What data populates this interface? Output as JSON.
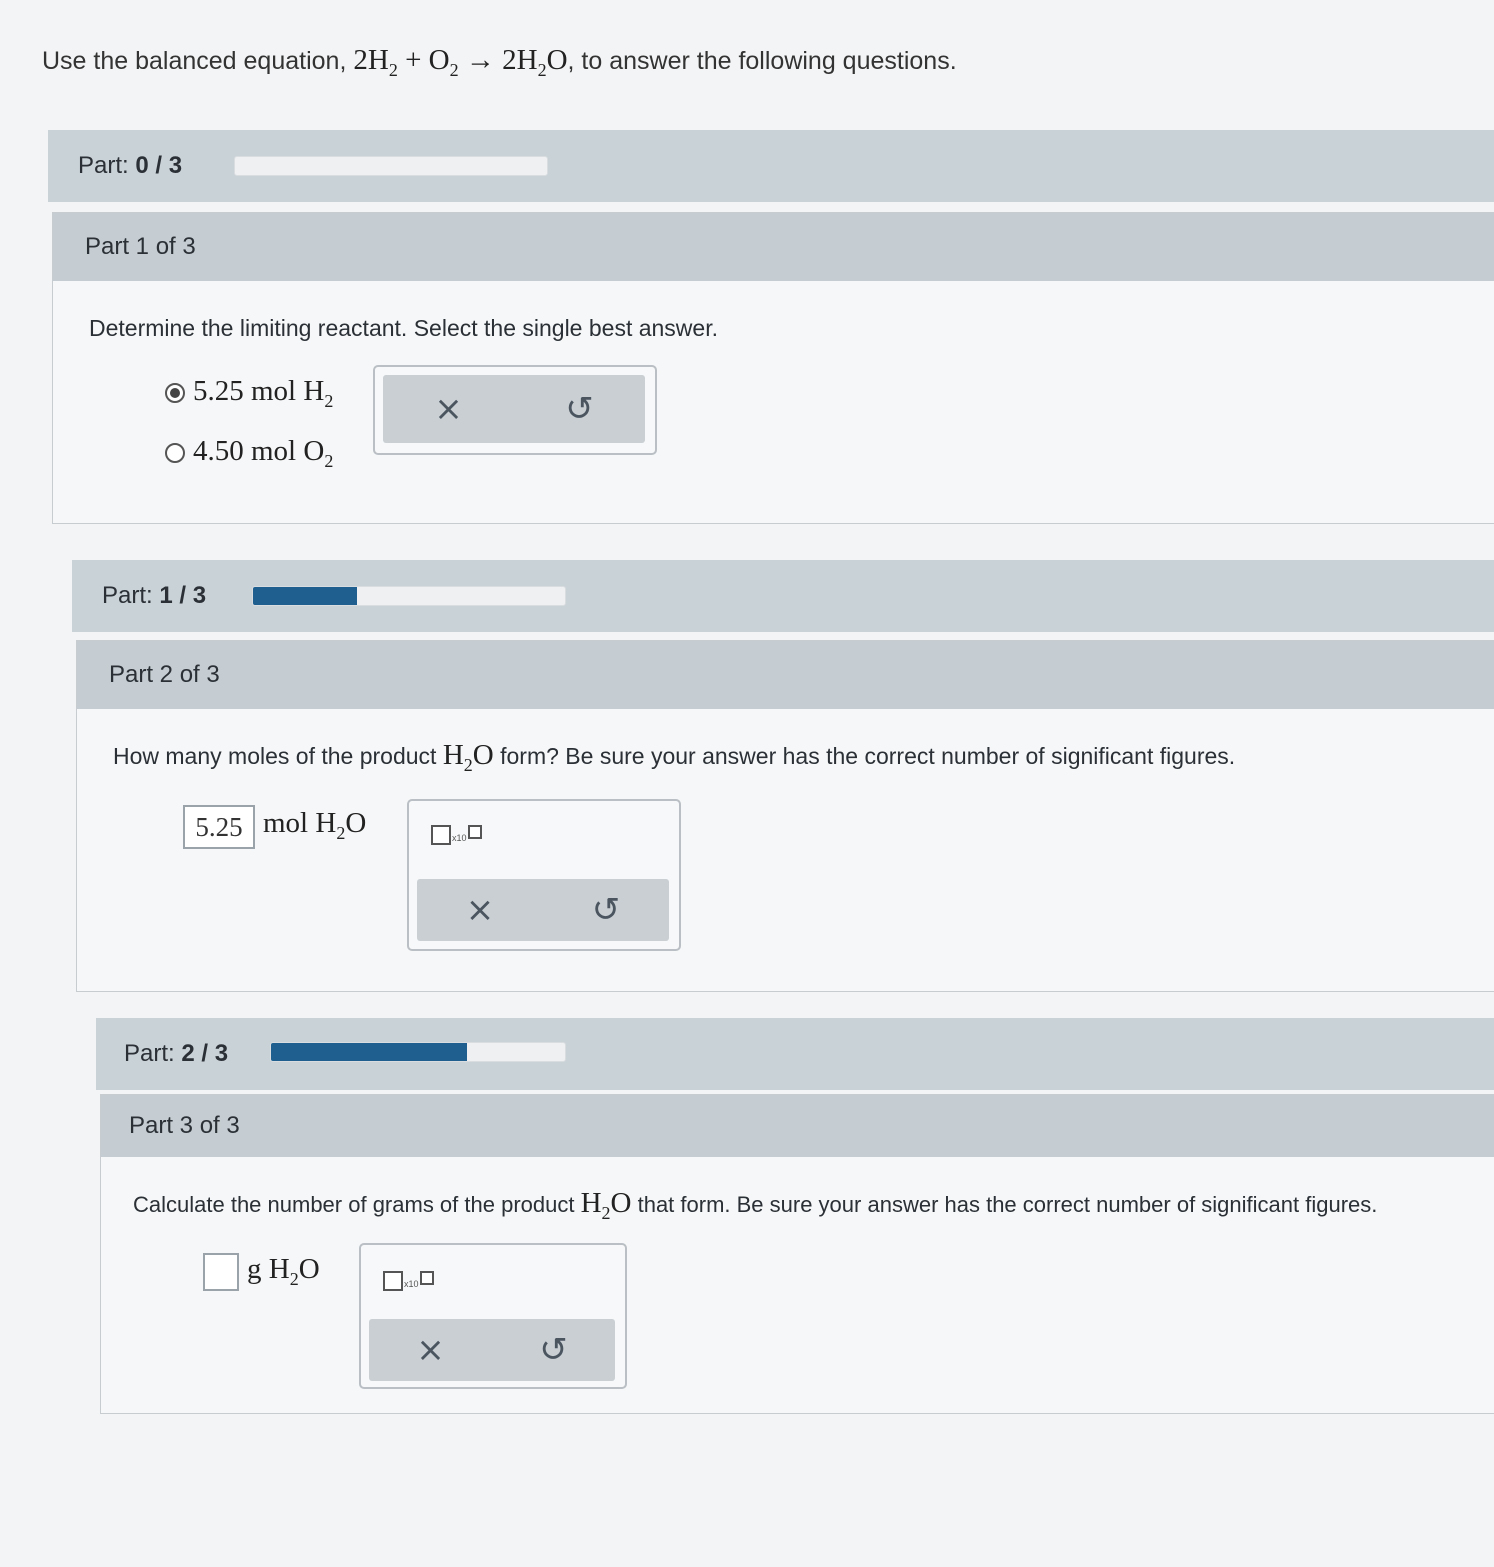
{
  "intro": {
    "prefix": "Use the balanced equation,",
    "suffix": ", to answer the following questions.",
    "equation": {
      "c1": "2H",
      "s1": "2",
      "plus": " + O",
      "s2": "2",
      "arrow": " → ",
      "c2": "2H",
      "s3": "2",
      "end": "O"
    }
  },
  "progress": [
    {
      "label": "Part:",
      "value": "0 / 3",
      "fraction": 0.0
    },
    {
      "label": "Part:",
      "value": "1 / 3",
      "fraction": 0.333
    },
    {
      "label": "Part:",
      "value": "2 / 3",
      "fraction": 0.667
    }
  ],
  "part1": {
    "header": "Part 1 of 3",
    "question": "Determine the limiting reactant. Select the single best answer.",
    "options": [
      {
        "amount": "5.25 mol H",
        "sub": "2",
        "selected": true
      },
      {
        "amount": "4.50 mol O",
        "sub": "2",
        "selected": false
      }
    ],
    "clear_icon": "×",
    "undo_icon": "↺"
  },
  "part2": {
    "header": "Part 2 of 3",
    "question_prefix": "How many moles of the product ",
    "question_formula": {
      "a": "H",
      "sub": "2",
      "b": "O"
    },
    "question_suffix": " form? Be sure your answer has the correct number of significant figures.",
    "answer_value": "5.25",
    "unit": {
      "a": "mol H",
      "sub": "2",
      "b": "O"
    },
    "sci_label": "x10",
    "clear_icon": "×",
    "undo_icon": "↺"
  },
  "part3": {
    "header": "Part 3 of 3",
    "question_prefix": "Calculate the number of grams of the product ",
    "question_formula": {
      "a": "H",
      "sub": "2",
      "b": "O"
    },
    "question_suffix": " that form. Be sure your answer has the correct number of significant figures.",
    "answer_value": "",
    "unit": {
      "a": "g H",
      "sub": "2",
      "b": "O"
    },
    "sci_label": "x10",
    "clear_icon": "×",
    "undo_icon": "↺"
  }
}
